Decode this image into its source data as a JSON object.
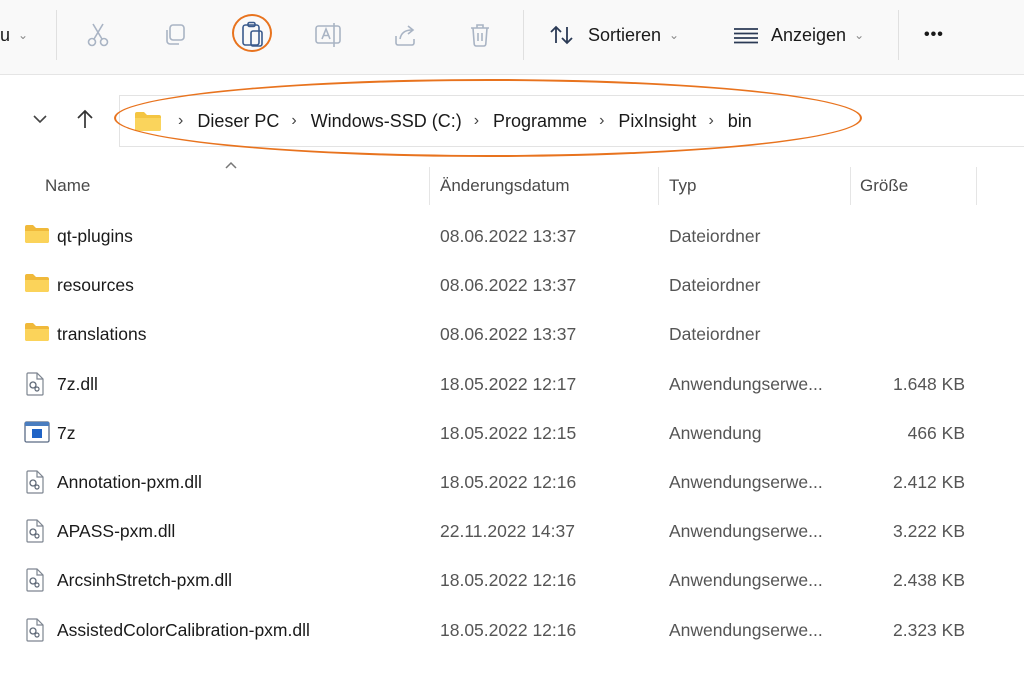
{
  "toolbar": {
    "partial_label": "u",
    "sort_label": "Sortieren",
    "view_label": "Anzeigen",
    "more_label": "•••"
  },
  "accent_color": "#e8731e",
  "breadcrumb": [
    "Dieser PC",
    "Windows-SSD (C:)",
    "Programme",
    "PixInsight",
    "bin"
  ],
  "columns": {
    "name": "Name",
    "date": "Änderungsdatum",
    "type": "Typ",
    "size": "Größe"
  },
  "files": [
    {
      "name": "qt-plugins",
      "date": "08.06.2022 13:37",
      "type": "Dateiordner",
      "size": "",
      "icon": "folder-icon"
    },
    {
      "name": "resources",
      "date": "08.06.2022 13:37",
      "type": "Dateiordner",
      "size": "",
      "icon": "folder-icon"
    },
    {
      "name": "translations",
      "date": "08.06.2022 13:37",
      "type": "Dateiordner",
      "size": "",
      "icon": "folder-icon"
    },
    {
      "name": "7z.dll",
      "date": "18.05.2022 12:17",
      "type": "Anwendungserwe...",
      "size": "1.648 KB",
      "icon": "dll-file-icon"
    },
    {
      "name": "7z",
      "date": "18.05.2022 12:15",
      "type": "Anwendung",
      "size": "466 KB",
      "icon": "application-icon"
    },
    {
      "name": "Annotation-pxm.dll",
      "date": "18.05.2022 12:16",
      "type": "Anwendungserwe...",
      "size": "2.412 KB",
      "icon": "dll-file-icon"
    },
    {
      "name": "APASS-pxm.dll",
      "date": "22.11.2022 14:37",
      "type": "Anwendungserwe...",
      "size": "3.222 KB",
      "icon": "dll-file-icon"
    },
    {
      "name": "ArcsinhStretch-pxm.dll",
      "date": "18.05.2022 12:16",
      "type": "Anwendungserwe...",
      "size": "2.438 KB",
      "icon": "dll-file-icon"
    },
    {
      "name": "AssistedColorCalibration-pxm.dll",
      "date": "18.05.2022 12:16",
      "type": "Anwendungserwe...",
      "size": "2.323 KB",
      "icon": "dll-file-icon"
    }
  ]
}
